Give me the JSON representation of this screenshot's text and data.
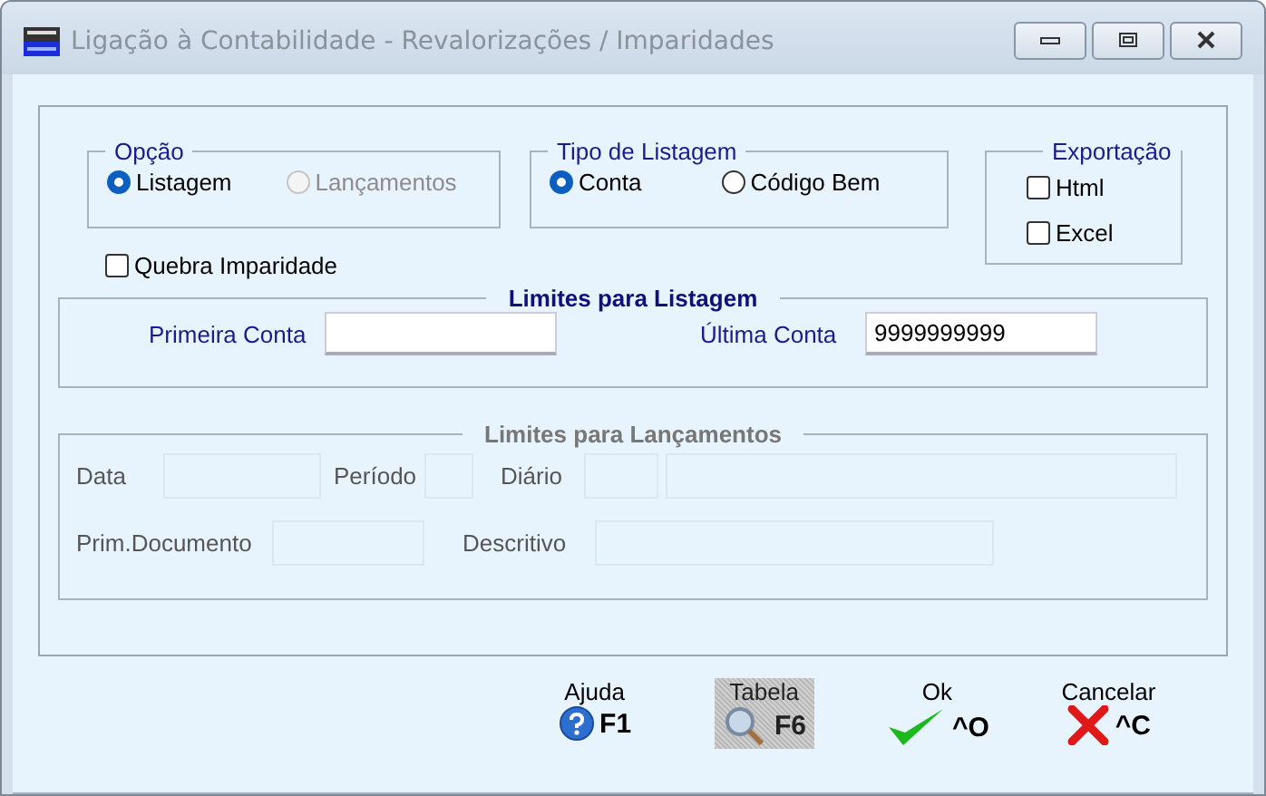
{
  "window": {
    "title": "Ligação à Contabilidade - Revalorizações / Imparidades"
  },
  "opcao": {
    "legend": "Opção",
    "options": [
      {
        "label": "Listagem",
        "selected": true,
        "disabled": false
      },
      {
        "label": "Lançamentos",
        "selected": false,
        "disabled": true
      }
    ]
  },
  "tipo_listagem": {
    "legend": "Tipo de Listagem",
    "options": [
      {
        "label": "Conta",
        "selected": true,
        "disabled": false
      },
      {
        "label": "Código Bem",
        "selected": false,
        "disabled": false
      }
    ]
  },
  "exportacao": {
    "legend": "Exportação",
    "options": [
      {
        "label": "Html",
        "checked": false
      },
      {
        "label": "Excel",
        "checked": false
      }
    ]
  },
  "quebra": {
    "label": "Quebra Imparidade",
    "checked": false
  },
  "limites_listagem": {
    "legend": "Limites para Listagem",
    "disabled": false,
    "fields": [
      {
        "label": "Primeira Conta"
      },
      {
        "label": "Última Conta",
        "value": "9999999999"
      }
    ]
  },
  "limites_lancamentos": {
    "legend": "Limites para Lançamentos",
    "disabled": true,
    "data": "Data",
    "periodo": "Período",
    "diario": "Diário",
    "prim_documento": "Prim.Documento",
    "descritivo": "Descritivo"
  },
  "buttons": [
    {
      "kind": "help",
      "label": "Ajuda",
      "key": "F1",
      "disabled": false
    },
    {
      "kind": "table",
      "label": "Tabela",
      "key": "F6",
      "disabled": true
    },
    {
      "kind": "ok",
      "label": "Ok",
      "key": "^O",
      "disabled": false
    },
    {
      "kind": "cancel",
      "label": "Cancelar",
      "key": "^C",
      "disabled": false
    }
  ]
}
